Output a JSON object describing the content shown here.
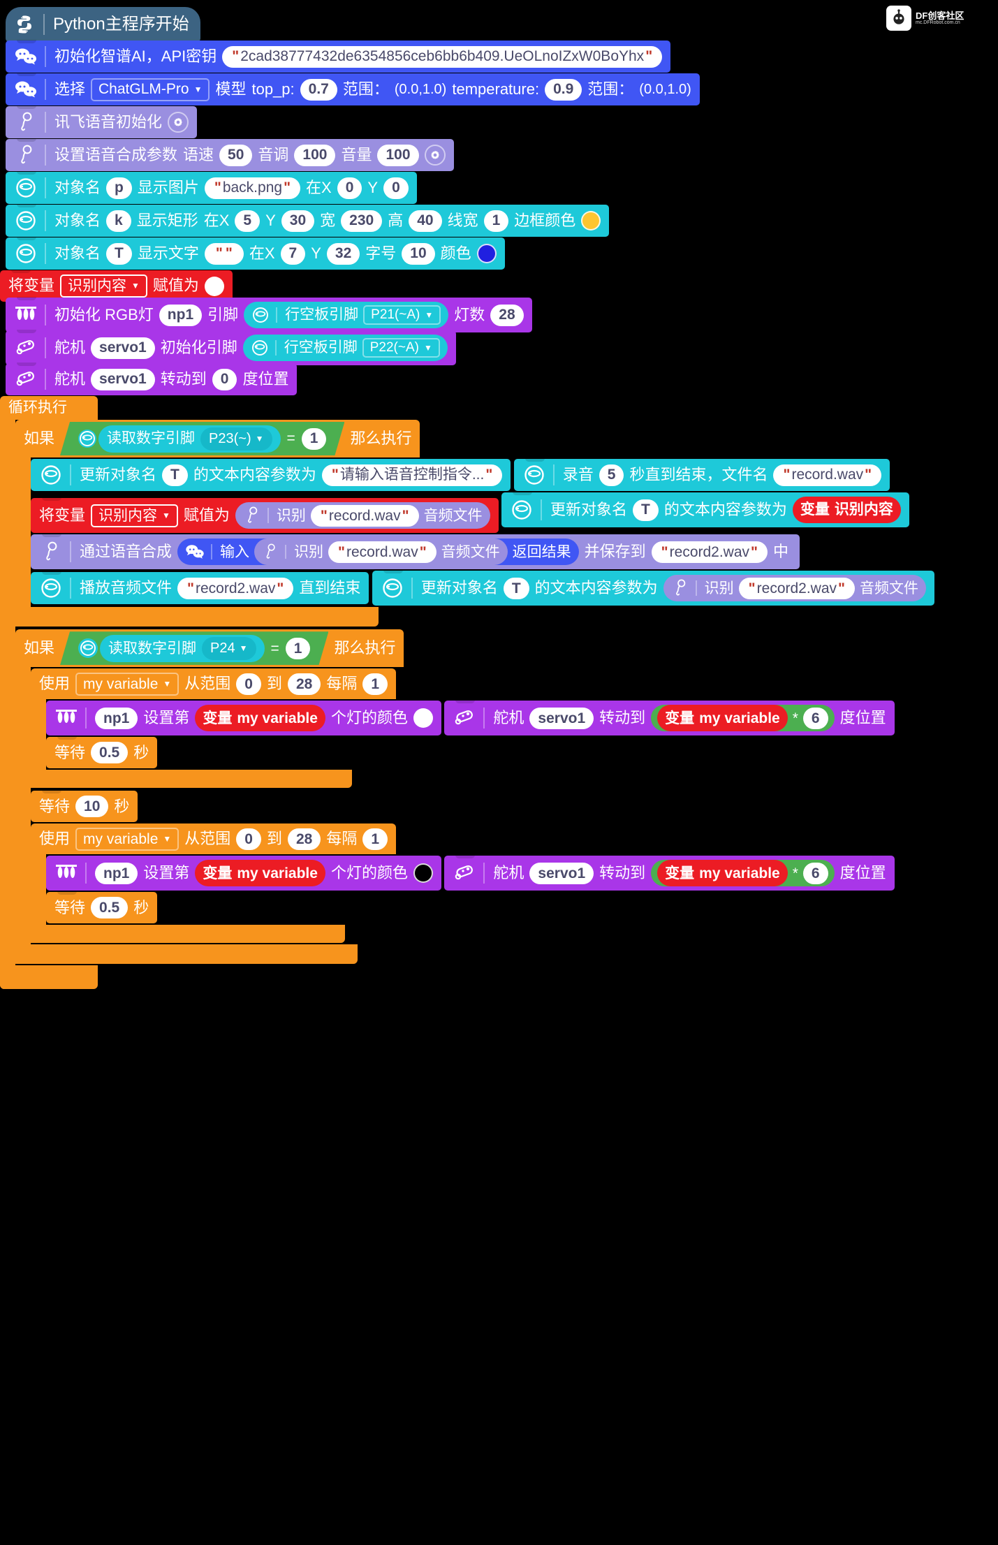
{
  "watermark": {
    "title": "DF创客社区",
    "subtitle": "mc.DFRobot.com.cn"
  },
  "hat": {
    "label": "Python主程序开始"
  },
  "blocks": {
    "zhipu_init": {
      "label": "初始化智谱AI，API密钥",
      "api_key": "2cad38777432de6354856ceb6bb6b409.UeOLnoIZxW0BoYhx"
    },
    "chatglm": {
      "select": "选择",
      "model": "ChatGLM-Pro",
      "model_word": "模型",
      "top_p_label": "top_p:",
      "top_p": "0.7",
      "range1_label": "范围：",
      "range1": "(0.0,1.0)",
      "temperature_label": "temperature:",
      "temperature": "0.9",
      "range2_label": "范围：",
      "range2": "(0.0,1.0)"
    },
    "xunfei_init": {
      "label": "讯飞语音初始化"
    },
    "tts_params": {
      "label": "设置语音合成参数",
      "rate_label": "语速",
      "rate": "50",
      "pitch_label": "音调",
      "pitch": "100",
      "volume_label": "音量",
      "volume": "100"
    },
    "show_image": {
      "obj_label": "对象名",
      "obj": "p",
      "action": "显示图片",
      "file": "back.png",
      "x_label": "在X",
      "x": "0",
      "y_label": "Y",
      "y": "0"
    },
    "show_rect": {
      "obj_label": "对象名",
      "obj": "k",
      "action": "显示矩形",
      "x_label": "在X",
      "x": "5",
      "y_label": "Y",
      "y": "30",
      "w_label": "宽",
      "w": "230",
      "h_label": "高",
      "h": "40",
      "lw_label": "线宽",
      "lw": "1",
      "border_label": "边框颜色",
      "border_color": "#fdc530"
    },
    "show_text": {
      "obj_label": "对象名",
      "obj": "T",
      "action": "显示文字",
      "text": "",
      "x_label": "在X",
      "x": "7",
      "y_label": "Y",
      "y": "32",
      "size_label": "字号",
      "size": "10",
      "color_label": "颜色",
      "color": "#2020e0"
    },
    "set_var_top": {
      "prefix": "将变量",
      "var": "识别内容",
      "suffix": "赋值为",
      "value_color": "#ffffff"
    },
    "rgb_init": {
      "label": "初始化 RGB灯",
      "name": "np1",
      "pin_label": "引脚",
      "pin_block": "行空板引脚",
      "pin": "P21(~A)",
      "count_label": "灯数",
      "count": "28"
    },
    "servo_init": {
      "label": "舵机",
      "name": "servo1",
      "action": "初始化引脚",
      "pin_block": "行空板引脚",
      "pin": "P22(~A)"
    },
    "servo_turn0": {
      "label": "舵机",
      "name": "servo1",
      "action": "转动到",
      "deg": "0",
      "unit": "度位置"
    },
    "forever": {
      "label": "循环执行"
    },
    "if1": {
      "if_label": "如果",
      "read_label": "读取数字引脚",
      "pin": "P23(~)",
      "op": "=",
      "value": "1",
      "then_label": "那么执行"
    },
    "update_text_prompt": {
      "prefix": "更新对象名",
      "obj": "T",
      "mid": "的文本内容参数为",
      "text": "请输入语音控制指令..."
    },
    "record": {
      "prefix": "录音",
      "secs": "5",
      "mid": "秒直到结束，文件名",
      "file": "record.wav"
    },
    "set_var_asr": {
      "prefix": "将变量",
      "var": "识别内容",
      "suffix": "赋值为",
      "rec_label": "识别",
      "file": "record.wav",
      "rec_suffix": "音频文件"
    },
    "update_text_var": {
      "prefix": "更新对象名",
      "obj": "T",
      "mid": "的文本内容参数为",
      "var_prefix": "变量",
      "var": "识别内容"
    },
    "tts_chain": {
      "prefix": "通过语音合成",
      "input_label": "输入",
      "rec_label": "识别",
      "rec_file": "record.wav",
      "rec_suffix": "音频文件",
      "ret_label": "返回结果",
      "save_label": "并保存到",
      "save_file": "record2.wav",
      "tail": "中"
    },
    "play_audio": {
      "prefix": "播放音频文件",
      "file": "record2.wav",
      "suffix": "直到结束"
    },
    "update_text_rec2": {
      "prefix": "更新对象名",
      "obj": "T",
      "mid": "的文本内容参数为",
      "rec_label": "识别",
      "file": "record2.wav",
      "rec_suffix": "音频文件"
    },
    "if2": {
      "if_label": "如果",
      "read_label": "读取数字引脚",
      "pin": "P24",
      "op": "=",
      "value": "1",
      "then_label": "那么执行"
    },
    "for_a": {
      "use_label": "使用",
      "var": "my variable",
      "from_label": "从范围",
      "from": "0",
      "to_label": "到",
      "to": "28",
      "step_label": "每隔",
      "step": "1"
    },
    "np_set_a": {
      "name": "np1",
      "prefix": "设置第",
      "var_prefix": "变量",
      "var": "my variable",
      "suffix": "个灯的颜色",
      "color": "#ffffff"
    },
    "servo_turn_a": {
      "label": "舵机",
      "name": "servo1",
      "action": "转动到",
      "var_prefix": "变量",
      "var": "my variable",
      "op": "*",
      "factor": "6",
      "unit": "度位置"
    },
    "wait_a": {
      "label": "等待",
      "secs": "0.5",
      "unit": "秒"
    },
    "wait_mid": {
      "label": "等待",
      "secs": "10",
      "unit": "秒"
    },
    "for_b": {
      "use_label": "使用",
      "var": "my variable",
      "from_label": "从范围",
      "from": "0",
      "to_label": "到",
      "to": "28",
      "step_label": "每隔",
      "step": "1"
    },
    "np_set_b": {
      "name": "np1",
      "prefix": "设置第",
      "var_prefix": "变量",
      "var": "my variable",
      "suffix": "个灯的颜色",
      "color": "#000000"
    },
    "servo_turn_b": {
      "label": "舵机",
      "name": "servo1",
      "action": "转动到",
      "var_prefix": "变量",
      "var": "my variable",
      "op": "*",
      "factor": "6",
      "unit": "度位置"
    },
    "wait_b": {
      "label": "等待",
      "secs": "0.5",
      "unit": "秒"
    }
  },
  "colors": {
    "hat": "#3c6382",
    "ai": "#4056f4",
    "voice": "#9a8fe0",
    "screen": "#1ec9d9",
    "variable": "#ec1c24",
    "rgb": "#a936e8",
    "control": "#f7941d",
    "boolean": "#4caf50"
  }
}
